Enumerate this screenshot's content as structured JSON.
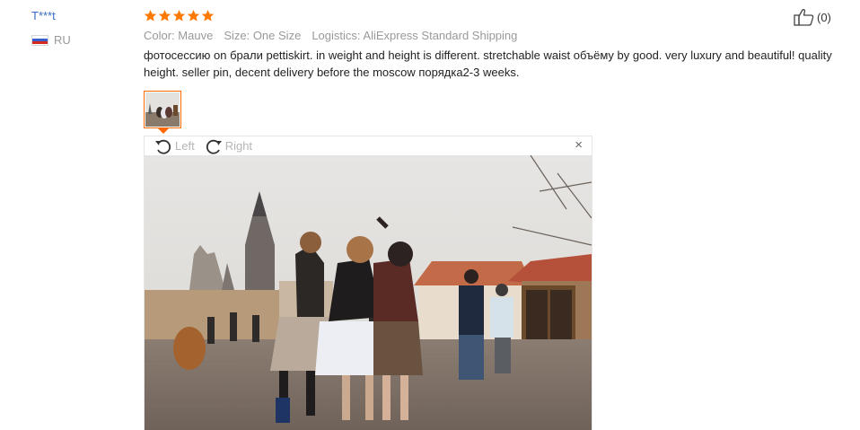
{
  "user": {
    "name": "T***t",
    "country_code": "RU",
    "flag_colors": [
      "#ffffff",
      "#3a5fcd",
      "#d52b1e"
    ]
  },
  "review": {
    "rating": 5,
    "star_color": "#ff7a00",
    "color": "Color: Mauve",
    "size": "Size: One Size",
    "logistics": "Logistics: AliExpress Standard Shipping",
    "text": "фотосессию on брали pettiskirt. in weight and height is different. stretchable waist объёму by good. very luxury and beautiful! quality height. seller pin, decent delivery before the moscow порядка2-3 weeks."
  },
  "viewer": {
    "rotate_left_label": "Left",
    "rotate_right_label": "Right",
    "close_icon": "×"
  },
  "like": {
    "count": "(0)"
  },
  "colors": {
    "accent": "#ff6a00",
    "link": "#3a6dc7",
    "muted": "#999999"
  }
}
